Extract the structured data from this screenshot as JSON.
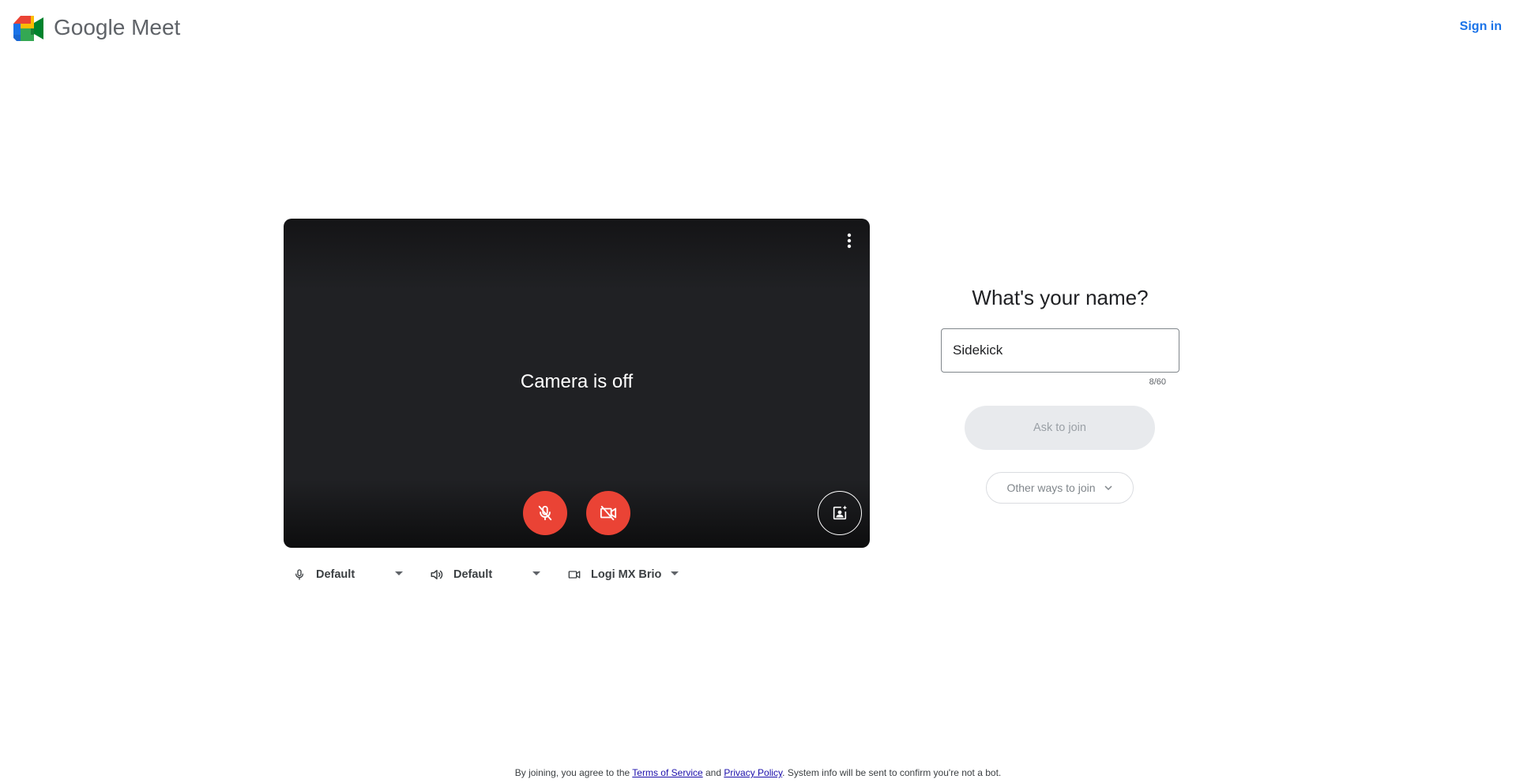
{
  "header": {
    "brand": "Google Meet",
    "sign_in": "Sign in",
    "logo_icon": "google-meet-logo"
  },
  "preview": {
    "status_text": "Camera is off",
    "mic_state": "muted",
    "camera_state": "off",
    "more_icon": "more-vert-icon",
    "effects_icon": "visual-effects-icon"
  },
  "devices": {
    "microphone": "Default",
    "speaker": "Default",
    "camera": "Logi MX Brio"
  },
  "join": {
    "title": "What's your name?",
    "name_value": "Sidekick",
    "char_count": "8/60",
    "ask_label": "Ask to join",
    "other_label": "Other ways to join"
  },
  "footer": {
    "prefix": "By joining, you agree to the ",
    "terms": "Terms of Service",
    "and": " and ",
    "privacy": "Privacy Policy",
    "suffix": ". System info will be sent to confirm you're not a bot."
  },
  "colors": {
    "accent": "#1a73e8",
    "danger": "#ea4335",
    "preview_bg": "#202124",
    "button_disabled": "#e8eaed"
  }
}
